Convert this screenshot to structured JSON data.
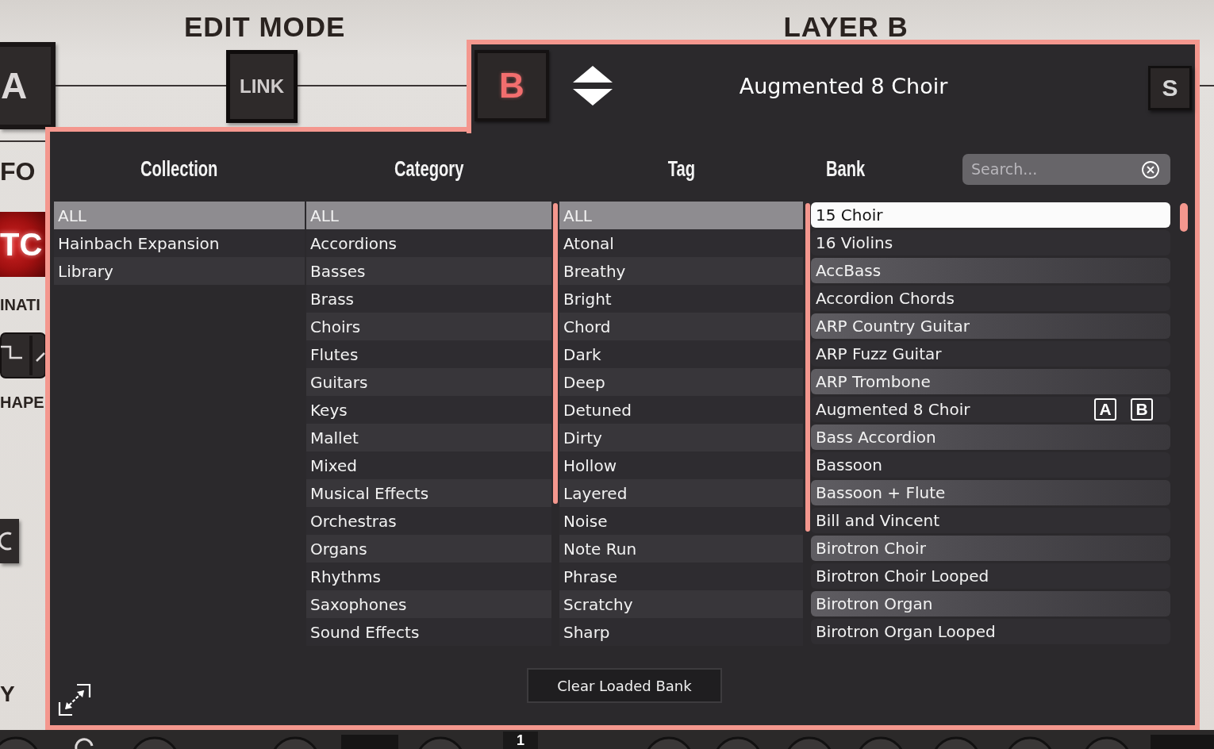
{
  "background": {
    "edit_mode_label": "EDIT MODE",
    "layer_label": "LAYER B",
    "layer_a_button": "A",
    "link_button": "LINK",
    "left_column": [
      {
        "kind": "label",
        "text": "FO"
      },
      {
        "kind": "lit_button",
        "text": "TC"
      },
      {
        "kind": "label",
        "text": "INATI"
      },
      {
        "kind": "wave_switch"
      },
      {
        "kind": "label",
        "text": "HAPE"
      },
      {
        "kind": "icon_button"
      },
      {
        "kind": "label",
        "text": "Y"
      }
    ],
    "bottom_strip": {
      "label": "1"
    }
  },
  "browser": {
    "layer_button": "B",
    "preset_title": "Augmented 8 Choir",
    "solo_button": "S",
    "search": {
      "placeholder": "Search..."
    },
    "columns": [
      {
        "kind": "filter",
        "heading": "Collection",
        "items": [
          {
            "label": "ALL",
            "selected": true
          },
          {
            "label": "Hainbach Expansion",
            "selected": false
          },
          {
            "label": "Library",
            "selected": false
          }
        ]
      },
      {
        "kind": "filter",
        "heading": "Category",
        "items": [
          {
            "label": "ALL",
            "selected": true
          },
          {
            "label": "Accordions",
            "selected": false
          },
          {
            "label": "Basses",
            "selected": false
          },
          {
            "label": "Brass",
            "selected": false
          },
          {
            "label": "Choirs",
            "selected": false
          },
          {
            "label": "Flutes",
            "selected": false
          },
          {
            "label": "Guitars",
            "selected": false
          },
          {
            "label": "Keys",
            "selected": false
          },
          {
            "label": "Mallet",
            "selected": false
          },
          {
            "label": "Mixed",
            "selected": false
          },
          {
            "label": "Musical Effects",
            "selected": false
          },
          {
            "label": "Orchestras",
            "selected": false
          },
          {
            "label": "Organs",
            "selected": false
          },
          {
            "label": "Rhythms",
            "selected": false
          },
          {
            "label": "Saxophones",
            "selected": false
          },
          {
            "label": "Sound Effects",
            "selected": false
          }
        ]
      },
      {
        "kind": "filter",
        "heading": "Tag",
        "items": [
          {
            "label": "ALL",
            "selected": true
          },
          {
            "label": "Atonal",
            "selected": false
          },
          {
            "label": "Breathy",
            "selected": false
          },
          {
            "label": "Bright",
            "selected": false
          },
          {
            "label": "Chord",
            "selected": false
          },
          {
            "label": "Dark",
            "selected": false
          },
          {
            "label": "Deep",
            "selected": false
          },
          {
            "label": "Detuned",
            "selected": false
          },
          {
            "label": "Dirty",
            "selected": false
          },
          {
            "label": "Hollow",
            "selected": false
          },
          {
            "label": "Layered",
            "selected": false
          },
          {
            "label": "Noise",
            "selected": false
          },
          {
            "label": "Note Run",
            "selected": false
          },
          {
            "label": "Phrase",
            "selected": false
          },
          {
            "label": "Scratchy",
            "selected": false
          },
          {
            "label": "Sharp",
            "selected": false
          }
        ]
      },
      {
        "kind": "bank",
        "heading": "Bank",
        "items": [
          {
            "label": "15 Choir",
            "selected": true
          },
          {
            "label": "16 Violins",
            "selected": false
          },
          {
            "label": "AccBass",
            "selected": false
          },
          {
            "label": "Accordion Chords",
            "selected": false
          },
          {
            "label": "ARP Country Guitar",
            "selected": false
          },
          {
            "label": "ARP Fuzz Guitar",
            "selected": false
          },
          {
            "label": "ARP Trombone",
            "selected": false
          },
          {
            "label": "Augmented 8 Choir",
            "selected": false,
            "loaded_in": [
              "A",
              "B"
            ]
          },
          {
            "label": "Bass Accordion",
            "selected": false
          },
          {
            "label": "Bassoon",
            "selected": false
          },
          {
            "label": "Bassoon + Flute",
            "selected": false
          },
          {
            "label": "Bill and Vincent",
            "selected": false
          },
          {
            "label": "Birotron Choir",
            "selected": false
          },
          {
            "label": "Birotron Choir Looped",
            "selected": false
          },
          {
            "label": "Birotron Organ",
            "selected": false
          },
          {
            "label": "Birotron Organ Looped",
            "selected": false
          }
        ]
      }
    ],
    "clear_button": "Clear Loaded Bank"
  }
}
